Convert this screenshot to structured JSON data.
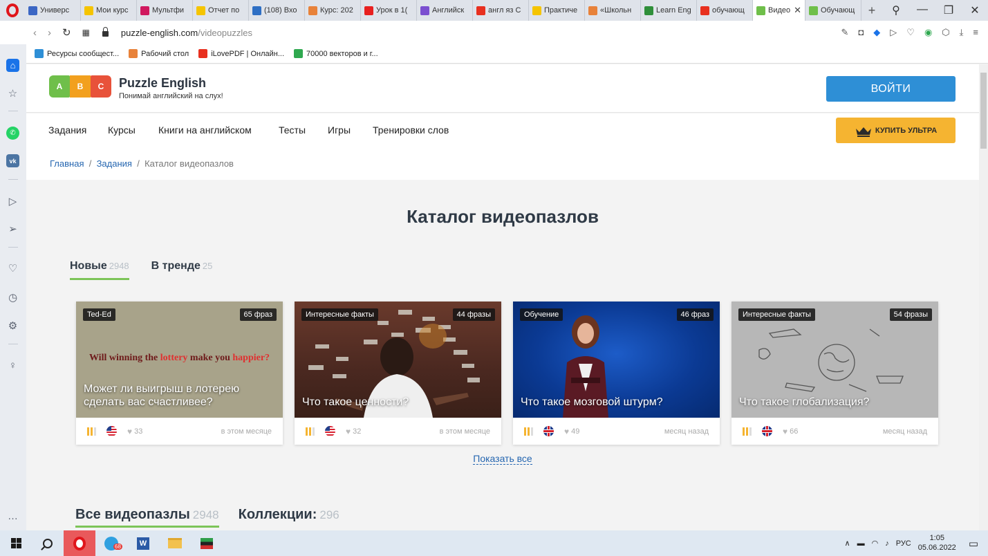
{
  "browser": {
    "tabs": [
      {
        "label": "Универс",
        "color": "#3b66c4"
      },
      {
        "label": "Мои курс",
        "color": "#f5c400"
      },
      {
        "label": "Мультфи",
        "color": "#d0195f"
      },
      {
        "label": "Отчет по",
        "color": "#f5c400"
      },
      {
        "label": "(108) Вхо",
        "color": "#2e6fc4"
      },
      {
        "label": "Курс: 202",
        "color": "#e8823a"
      },
      {
        "label": "Урок в 1(",
        "color": "#e8201f"
      },
      {
        "label": "Английск",
        "color": "#7b4fd0"
      },
      {
        "label": "англ яз С",
        "color": "#e8301f"
      },
      {
        "label": "Практиче",
        "color": "#f5c400"
      },
      {
        "label": "«Школьн",
        "color": "#e8823a"
      },
      {
        "label": "Learn Eng",
        "color": "#2f8f3a"
      },
      {
        "label": "обучающ",
        "color": "#e8301f"
      }
    ],
    "active_tab": {
      "label": "Видео",
      "color": "#6fbf4a"
    },
    "extra_tab": {
      "label": "Обучающ",
      "color": "#6fbf4a"
    },
    "url_host": "puzzle-english.com",
    "url_path": "/videopuzzles",
    "bookmarks": [
      {
        "label": "Ресурсы сообщест...",
        "color": "#2e8fd6"
      },
      {
        "label": "Рабочий стол",
        "color": "#e8823a"
      },
      {
        "label": "iLovePDF | Онлайн...",
        "color": "#e8301f"
      },
      {
        "label": "70000 векторов и г...",
        "color": "#2fa84f"
      }
    ]
  },
  "site": {
    "brand_name": "Puzzle English",
    "brand_tagline": "Понимай английский на слух!",
    "logo_letters": [
      "A",
      "B",
      "C"
    ],
    "login_label": "ВОЙТИ",
    "nav": [
      "Задания",
      "Курсы",
      "Книги на английском",
      "Тесты",
      "Игры",
      "Тренировки слов"
    ],
    "ultra_label": "КУПИТЬ УЛЬТРА",
    "breadcrumb": {
      "home": "Главная",
      "sep": "/",
      "tasks": "Задания",
      "current": "Каталог видеопазлов"
    },
    "page_title": "Каталог видеопазлов",
    "tabs": [
      {
        "label": "Новые",
        "count": "2948"
      },
      {
        "label": "В тренде",
        "count": "25"
      }
    ],
    "cards": [
      {
        "category": "Ted-Ed",
        "phrases": "65 фраз",
        "title": "Может ли выигрыш в лотерею сделать вас счастливее?",
        "quote_a": "Will winning the ",
        "quote_b": "lottery",
        "quote_c": " make you ",
        "quote_d": "happier?",
        "likes": "33",
        "date": "в этом месяце",
        "flag": "us"
      },
      {
        "category": "Интересные факты",
        "phrases": "44 фразы",
        "title": "Что такое ценности?",
        "likes": "32",
        "date": "в этом месяце",
        "flag": "us"
      },
      {
        "category": "Обучение",
        "phrases": "46 фраз",
        "title": "Что такое мозговой штурм?",
        "likes": "49",
        "date": "месяц назад",
        "flag": "uk"
      },
      {
        "category": "Интересные факты",
        "phrases": "54 фразы",
        "title": "Что такое глобализация?",
        "likes": "66",
        "date": "месяц назад",
        "flag": "uk"
      }
    ],
    "show_all": "Показать все",
    "bottom_tabs": [
      {
        "label": "Все видеопазлы",
        "count": "2948"
      },
      {
        "label": "Коллекции:",
        "count": "296"
      }
    ]
  },
  "taskbar": {
    "telegram_badge": "68",
    "lang": "РУС",
    "time": "1:05",
    "date": "05.06.2022"
  }
}
